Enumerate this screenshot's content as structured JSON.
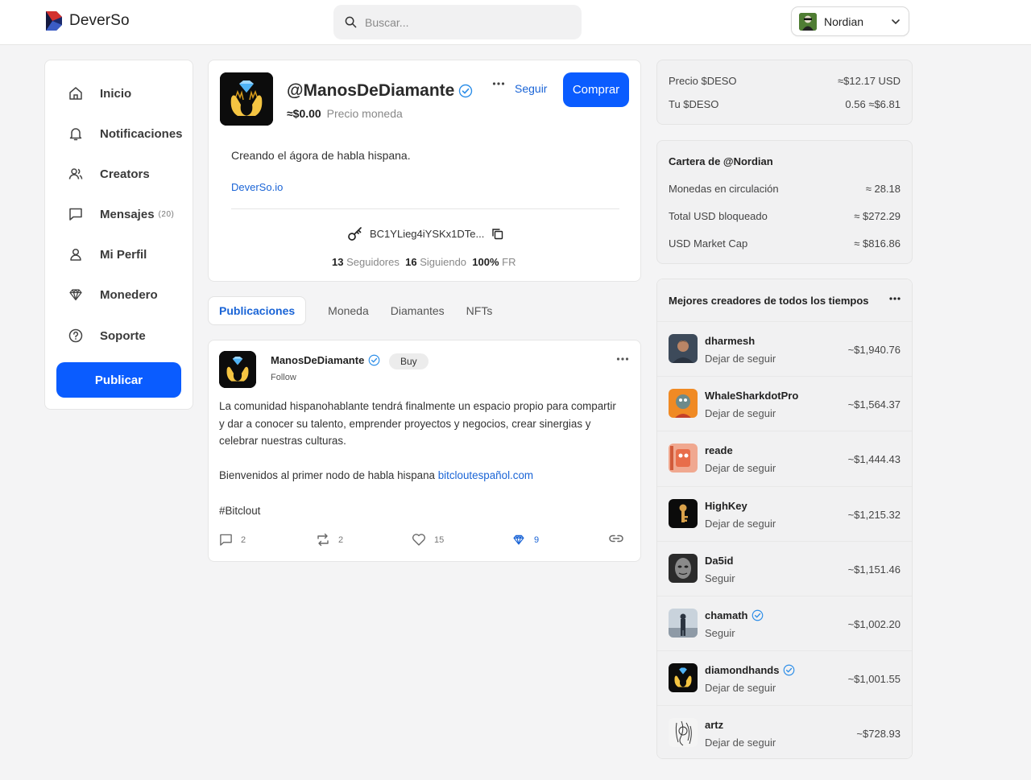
{
  "brand": {
    "name": "DeverSo",
    "accent": "#0a5cff",
    "link": "#1a64d6"
  },
  "search": {
    "placeholder": "Buscar..."
  },
  "user": {
    "name": "Nordian"
  },
  "sidebar": {
    "items": [
      {
        "label": "Inicio",
        "icon": "home-icon"
      },
      {
        "label": "Notificaciones",
        "icon": "bell-icon"
      },
      {
        "label": "Creators",
        "icon": "users-icon"
      },
      {
        "label": "Mensajes",
        "icon": "message-icon",
        "count": "(20)"
      },
      {
        "label": "Mi Perfil",
        "icon": "user-icon"
      },
      {
        "label": "Monedero",
        "icon": "diamond-icon"
      },
      {
        "label": "Soporte",
        "icon": "help-icon"
      }
    ],
    "publish_label": "Publicar"
  },
  "profile": {
    "handle": "@ManosDeDiamante",
    "price": "≈$0.00",
    "price_label": "Precio moneda",
    "follow_label": "Seguir",
    "buy_label": "Comprar",
    "bio": "Creando el ágora de habla hispana.",
    "link": "DeverSo.io",
    "public_key": "BC1YLieg4iYSKx1DTe...",
    "followers_count": "13",
    "followers_label": "Seguidores",
    "following_count": "16",
    "following_label": "Siguiendo",
    "fr_value": "100%",
    "fr_label": "FR"
  },
  "tabs": [
    "Publicaciones",
    "Moneda",
    "Diamantes",
    "NFTs"
  ],
  "post": {
    "author": "ManosDeDiamante",
    "buy_label": "Buy",
    "follow_label": "Follow",
    "paragraph1": "La comunidad hispanohablante tendrá finalmente un espacio propio para compartir y dar a conocer su talento, emprender proyectos y negocios, crear sinergias y celebrar nuestras culturas.",
    "paragraph2_text": "Bienvenidos al primer nodo de habla hispana ",
    "paragraph2_link": "bitcloutespañol.com",
    "hashtag": "#Bitclout",
    "comments": "2",
    "reclouts": "2",
    "likes": "15",
    "diamonds": "9"
  },
  "price_card": {
    "deso_price_label": "Precio $DESO",
    "deso_price_value": "≈$12.17 USD",
    "your_deso_label": "Tu $DESO",
    "your_deso_value": "0.56 ≈$6.81"
  },
  "wallet_card": {
    "title": "Cartera de @Nordian",
    "rows": [
      {
        "label": "Monedas en circulación",
        "value": "≈ 28.18"
      },
      {
        "label": "Total USD bloqueado",
        "value": "≈ $272.29"
      },
      {
        "label": "USD Market Cap",
        "value": "≈ $816.86"
      }
    ]
  },
  "top_creators": {
    "title": "Mejores creadores de todos los tiempos",
    "items": [
      {
        "name": "dharmesh",
        "action": "Dejar de seguir",
        "value": "~$1,940.76",
        "verified": false
      },
      {
        "name": "WhaleSharkdotPro",
        "action": "Dejar de seguir",
        "value": "~$1,564.37",
        "verified": false
      },
      {
        "name": "reade",
        "action": "Dejar de seguir",
        "value": "~$1,444.43",
        "verified": false
      },
      {
        "name": "HighKey",
        "action": "Dejar de seguir",
        "value": "~$1,215.32",
        "verified": false
      },
      {
        "name": "Da5id",
        "action": "Seguir",
        "value": "~$1,151.46",
        "verified": false
      },
      {
        "name": "chamath",
        "action": "Seguir",
        "value": "~$1,002.20",
        "verified": true
      },
      {
        "name": "diamondhands",
        "action": "Dejar de seguir",
        "value": "~$1,001.55",
        "verified": true
      },
      {
        "name": "artz",
        "action": "Dejar de seguir",
        "value": "~$728.93",
        "verified": false
      }
    ]
  }
}
